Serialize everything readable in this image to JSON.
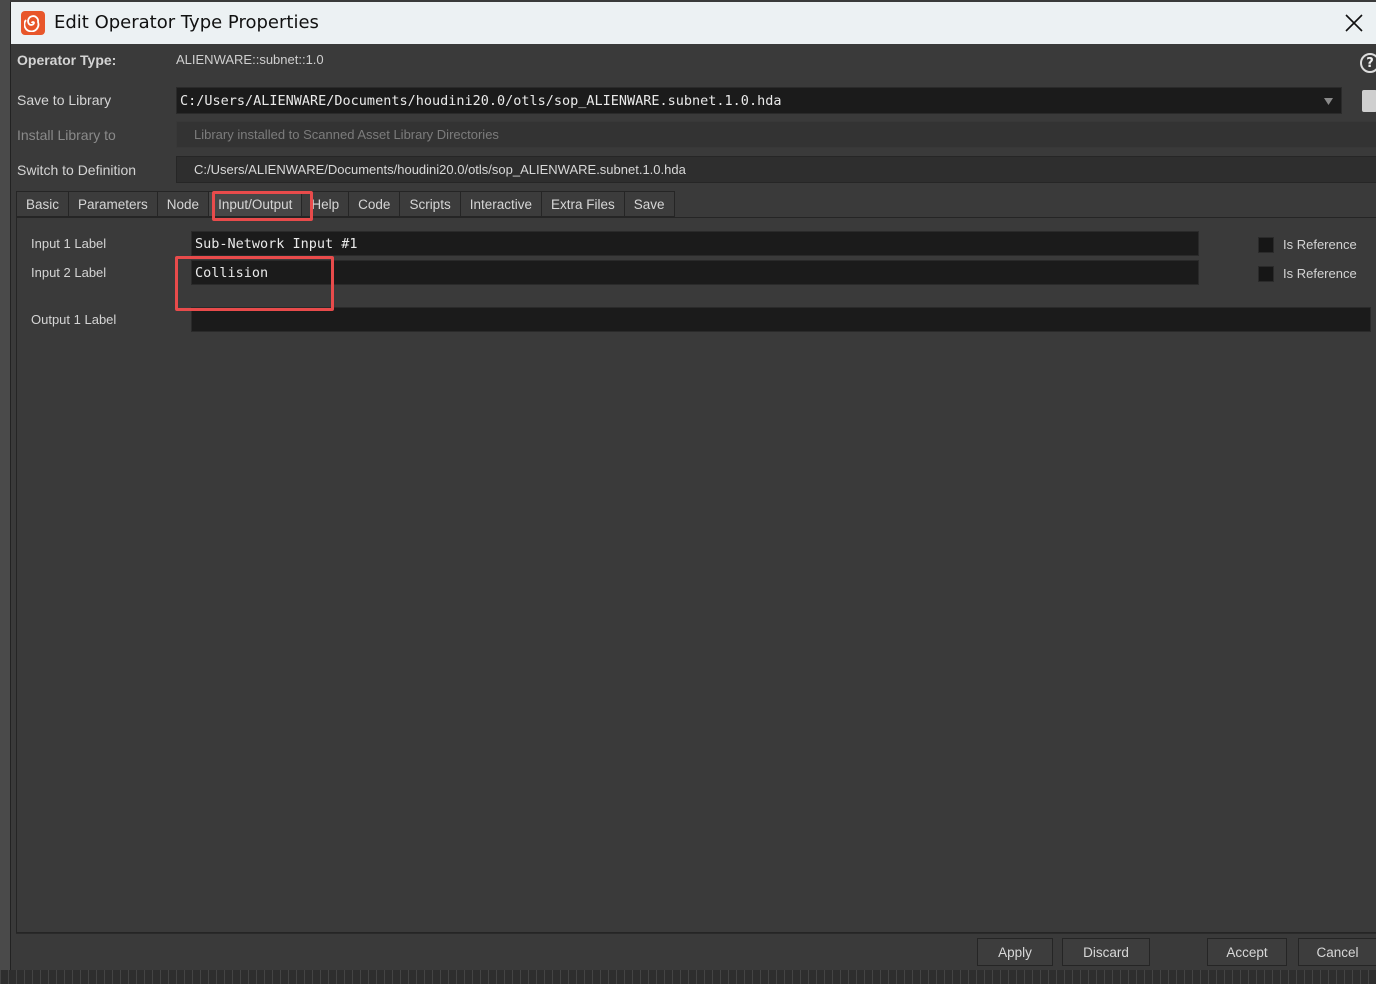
{
  "window": {
    "title": "Edit Operator Type Properties"
  },
  "header": {
    "operator_type_label": "Operator Type:",
    "operator_type_value": "ALIENWARE::subnet::1.0",
    "save_to_library_label": "Save to Library",
    "save_to_library_value": "C:/Users/ALIENWARE/Documents/houdini20.0/otls/sop_ALIENWARE.subnet.1.0.hda",
    "install_library_label": "Install Library to",
    "install_library_value": "Library installed to Scanned Asset Library Directories",
    "switch_definition_label": "Switch to Definition",
    "switch_definition_value": "C:/Users/ALIENWARE/Documents/houdini20.0/otls/sop_ALIENWARE.subnet.1.0.hda",
    "help_symbol": "?"
  },
  "tabs": [
    {
      "label": "Basic"
    },
    {
      "label": "Parameters"
    },
    {
      "label": "Node"
    },
    {
      "label": "Input/Output",
      "active": true
    },
    {
      "label": "Help"
    },
    {
      "label": "Code"
    },
    {
      "label": "Scripts"
    },
    {
      "label": "Interactive"
    },
    {
      "label": "Extra Files"
    },
    {
      "label": "Save"
    }
  ],
  "io": {
    "input1_label": "Input 1 Label",
    "input1_value": "Sub-Network Input #1",
    "input2_label": "Input 2 Label",
    "input2_value": "Collision",
    "output1_label": "Output 1 Label",
    "output1_value": "",
    "is_reference_label": "Is Reference"
  },
  "footer": {
    "apply": "Apply",
    "discard": "Discard",
    "accept": "Accept",
    "cancel": "Cancel"
  },
  "colors": {
    "highlight": "#e84b4b",
    "app_icon": "#e8562a"
  }
}
